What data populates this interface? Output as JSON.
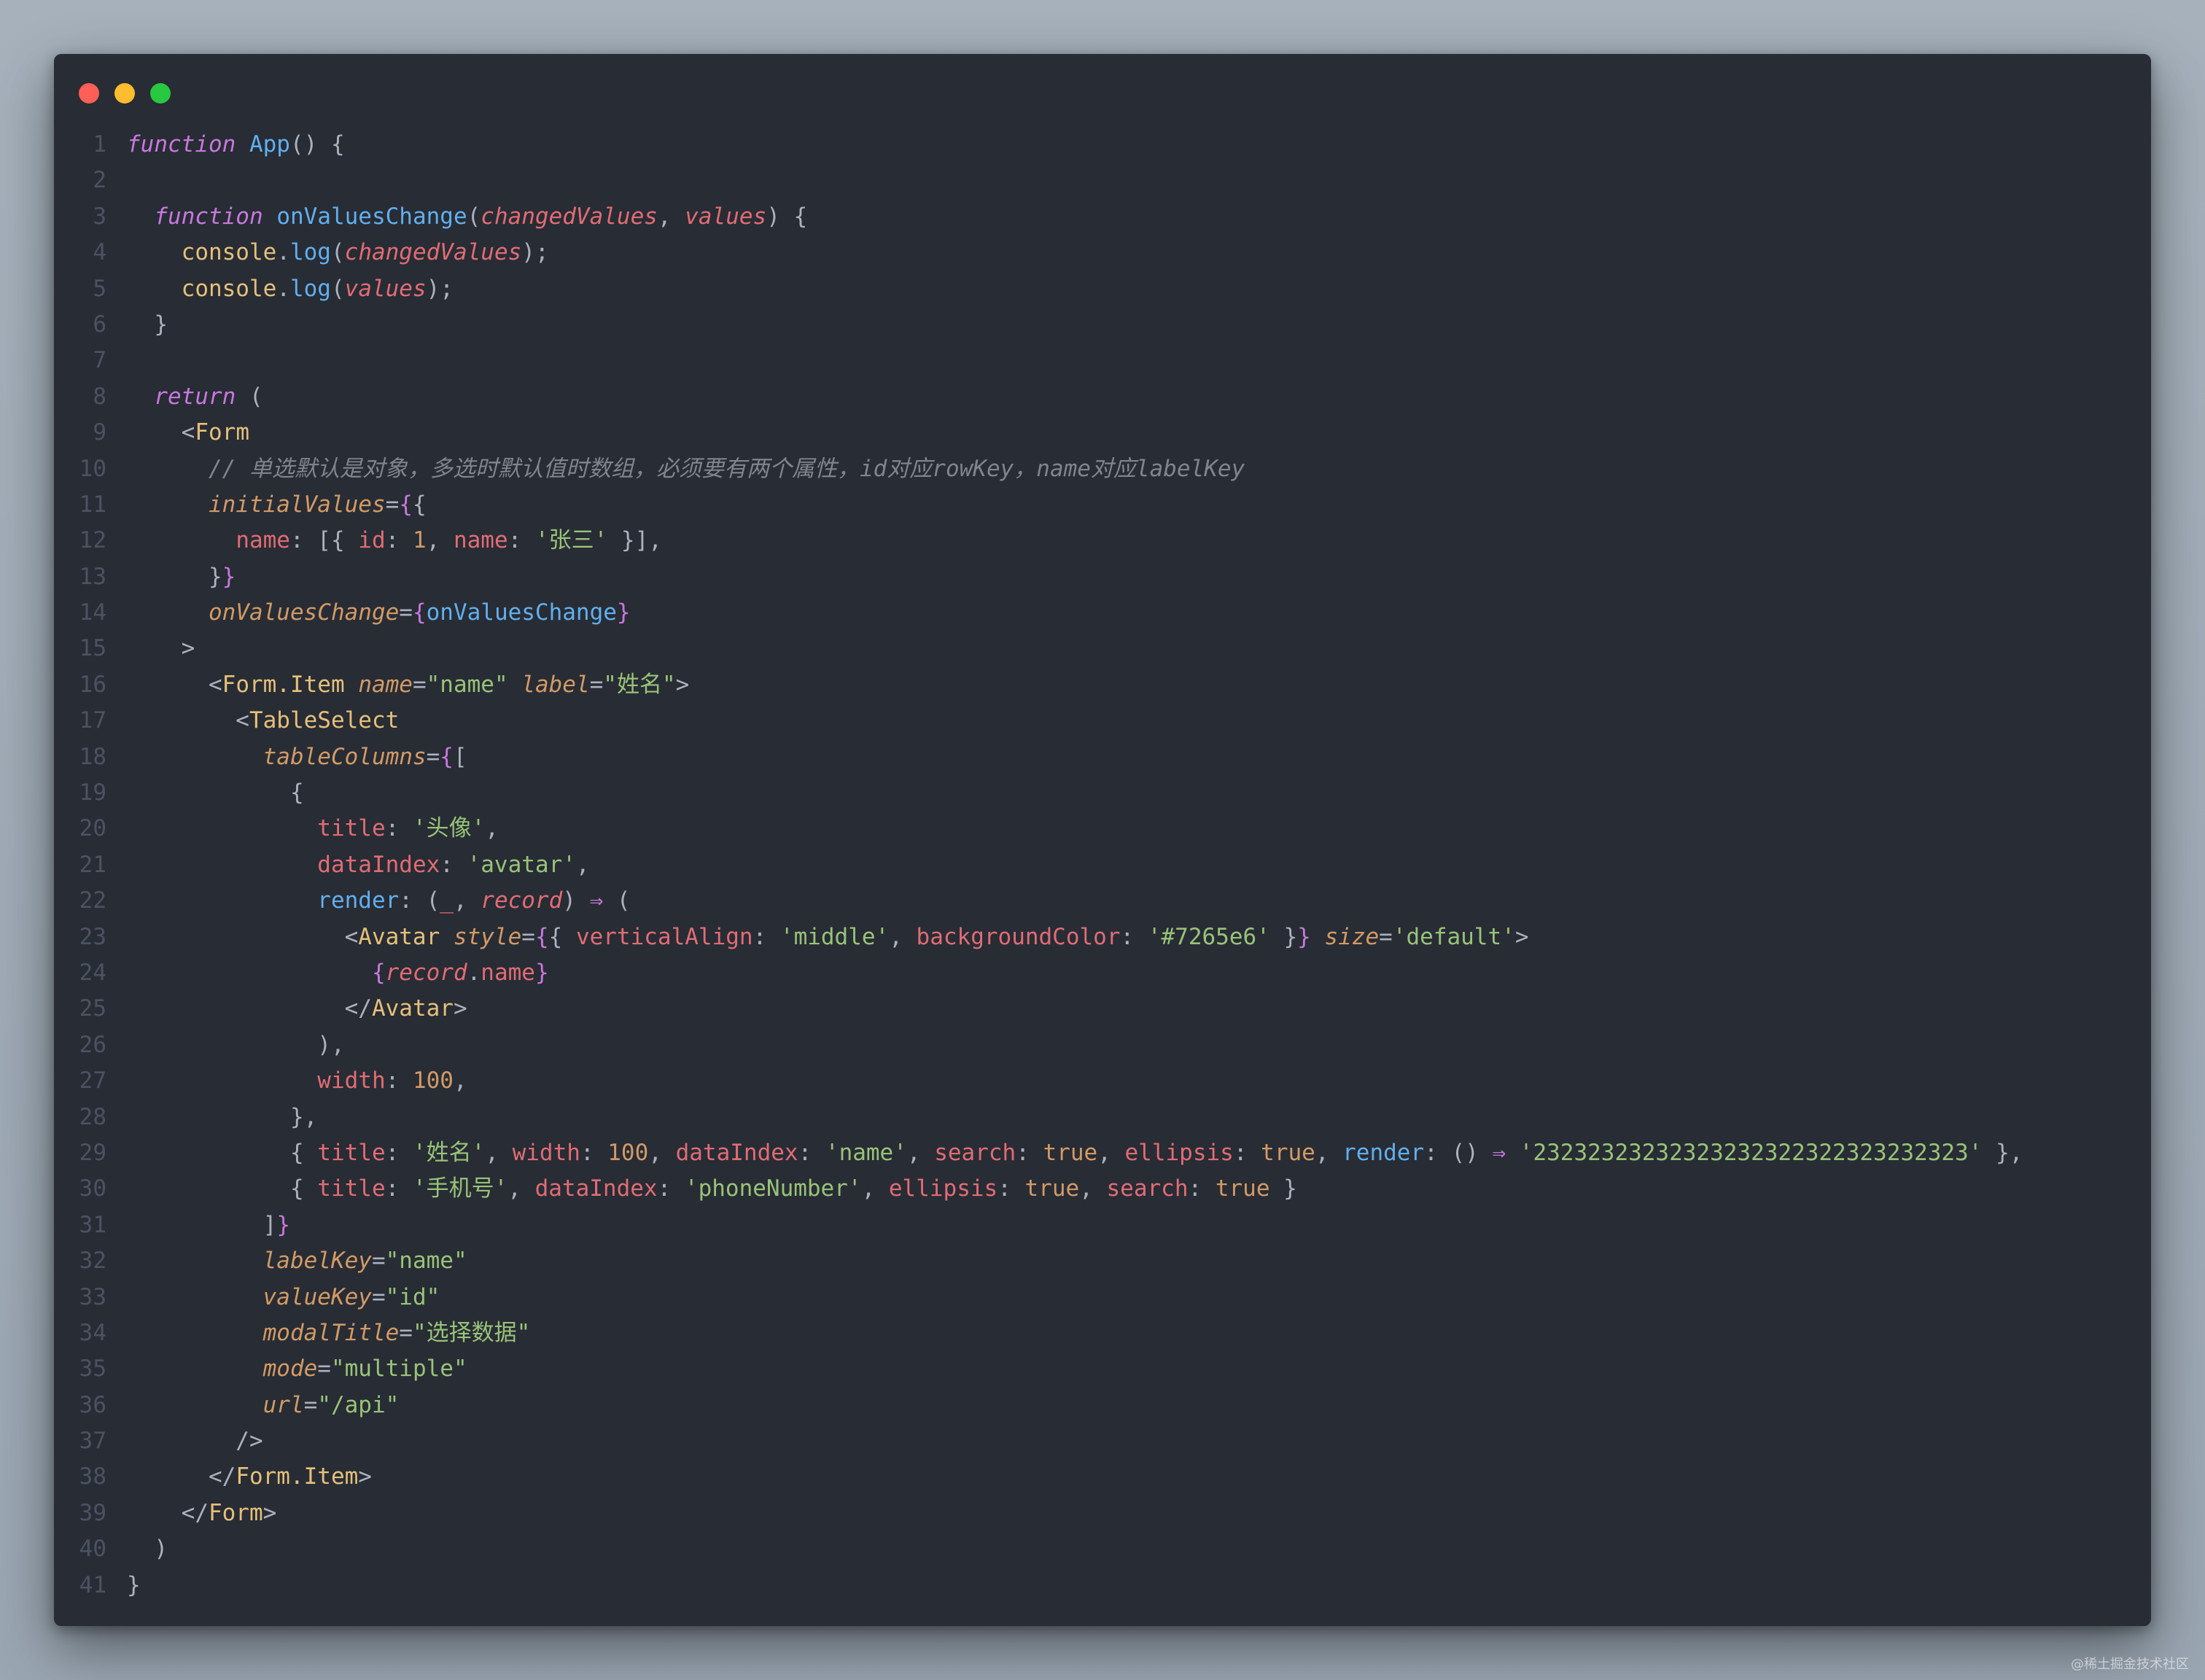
{
  "window": {
    "traffic_lights": [
      {
        "name": "close",
        "color": "#ff5f57"
      },
      {
        "name": "minimize",
        "color": "#febc2e"
      },
      {
        "name": "maximize",
        "color": "#28c840"
      }
    ]
  },
  "colors": {
    "background": "#282c34",
    "kw": "#c678dd",
    "fn": "#61afef",
    "param": "#e06c75",
    "prop": "#e06c75",
    "str": "#98c379",
    "num": "#d19a66",
    "attr": "#d19a66",
    "tag": "#e5c07b",
    "comment": "#7f848e",
    "punc": "#abb2bf",
    "brace": "#c678dd",
    "obj": "#e5c07b",
    "bool": "#d19a66"
  },
  "code": {
    "lines": [
      {
        "n": "1",
        "t": [
          [
            "kw",
            "function",
            1
          ],
          [
            "p",
            " "
          ],
          [
            "fn",
            "App"
          ],
          [
            "p",
            "() {"
          ]
        ]
      },
      {
        "n": "2",
        "t": []
      },
      {
        "n": "3",
        "t": [
          [
            "p",
            "  "
          ],
          [
            "kw",
            "function",
            1
          ],
          [
            "p",
            " "
          ],
          [
            "fn",
            "onValuesChange"
          ],
          [
            "p",
            "("
          ],
          [
            "param",
            "changedValues",
            1
          ],
          [
            "p",
            ", "
          ],
          [
            "param",
            "values",
            1
          ],
          [
            "p",
            ") {"
          ]
        ]
      },
      {
        "n": "4",
        "t": [
          [
            "p",
            "    "
          ],
          [
            "obj",
            "console"
          ],
          [
            "p",
            "."
          ],
          [
            "fn",
            "log"
          ],
          [
            "p",
            "("
          ],
          [
            "param",
            "changedValues",
            1
          ],
          [
            "p",
            ");"
          ]
        ]
      },
      {
        "n": "5",
        "t": [
          [
            "p",
            "    "
          ],
          [
            "obj",
            "console"
          ],
          [
            "p",
            "."
          ],
          [
            "fn",
            "log"
          ],
          [
            "p",
            "("
          ],
          [
            "param",
            "values",
            1
          ],
          [
            "p",
            ");"
          ]
        ]
      },
      {
        "n": "6",
        "t": [
          [
            "p",
            "  }"
          ]
        ]
      },
      {
        "n": "7",
        "t": []
      },
      {
        "n": "8",
        "t": [
          [
            "p",
            "  "
          ],
          [
            "kw",
            "return",
            1
          ],
          [
            "p",
            " ("
          ]
        ]
      },
      {
        "n": "9",
        "t": [
          [
            "p",
            "    <"
          ],
          [
            "tag",
            "Form"
          ]
        ]
      },
      {
        "n": "10",
        "t": [
          [
            "p",
            "      "
          ],
          [
            "comment",
            "// 单选默认是对象，多选时默认值时数组，必须要有两个属性，id对应rowKey，name对应labelKey",
            1
          ]
        ]
      },
      {
        "n": "11",
        "t": [
          [
            "p",
            "      "
          ],
          [
            "attr",
            "initialValues",
            1
          ],
          [
            "p",
            "="
          ],
          [
            "brace",
            "{"
          ],
          [
            "p",
            "{"
          ]
        ]
      },
      {
        "n": "12",
        "t": [
          [
            "p",
            "        "
          ],
          [
            "prop",
            "name"
          ],
          [
            "p",
            ": [{ "
          ],
          [
            "prop",
            "id"
          ],
          [
            "p",
            ": "
          ],
          [
            "num",
            "1"
          ],
          [
            "p",
            ", "
          ],
          [
            "prop",
            "name"
          ],
          [
            "p",
            ": "
          ],
          [
            "str",
            "'张三'"
          ],
          [
            "p",
            " }],"
          ]
        ]
      },
      {
        "n": "13",
        "t": [
          [
            "p",
            "      }"
          ],
          [
            "brace",
            "}"
          ]
        ]
      },
      {
        "n": "14",
        "t": [
          [
            "p",
            "      "
          ],
          [
            "attr",
            "onValuesChange",
            1
          ],
          [
            "p",
            "="
          ],
          [
            "brace",
            "{"
          ],
          [
            "fn",
            "onValuesChange"
          ],
          [
            "brace",
            "}"
          ]
        ]
      },
      {
        "n": "15",
        "t": [
          [
            "p",
            "    >"
          ]
        ]
      },
      {
        "n": "16",
        "t": [
          [
            "p",
            "      <"
          ],
          [
            "tag",
            "Form.Item"
          ],
          [
            "p",
            " "
          ],
          [
            "attr",
            "name",
            1
          ],
          [
            "p",
            "="
          ],
          [
            "str",
            "\"name\""
          ],
          [
            "p",
            " "
          ],
          [
            "attr",
            "label",
            1
          ],
          [
            "p",
            "="
          ],
          [
            "str",
            "\"姓名\""
          ],
          [
            "p",
            ">"
          ]
        ]
      },
      {
        "n": "17",
        "t": [
          [
            "p",
            "        <"
          ],
          [
            "tag",
            "TableSelect"
          ]
        ]
      },
      {
        "n": "18",
        "t": [
          [
            "p",
            "          "
          ],
          [
            "attr",
            "tableColumns",
            1
          ],
          [
            "p",
            "="
          ],
          [
            "brace",
            "{"
          ],
          [
            "p",
            "["
          ]
        ]
      },
      {
        "n": "19",
        "t": [
          [
            "p",
            "            {"
          ]
        ]
      },
      {
        "n": "20",
        "t": [
          [
            "p",
            "              "
          ],
          [
            "prop",
            "title"
          ],
          [
            "p",
            ": "
          ],
          [
            "str",
            "'头像'"
          ],
          [
            "p",
            ","
          ]
        ]
      },
      {
        "n": "21",
        "t": [
          [
            "p",
            "              "
          ],
          [
            "prop",
            "dataIndex"
          ],
          [
            "p",
            ": "
          ],
          [
            "str",
            "'avatar'"
          ],
          [
            "p",
            ","
          ]
        ]
      },
      {
        "n": "22",
        "t": [
          [
            "p",
            "              "
          ],
          [
            "fn",
            "render"
          ],
          [
            "p",
            ": ("
          ],
          [
            "param",
            "_"
          ],
          [
            "p",
            ", "
          ],
          [
            "param",
            "record",
            1
          ],
          [
            "p",
            ") "
          ],
          [
            "kw",
            "⇒"
          ],
          [
            "p",
            " ("
          ]
        ]
      },
      {
        "n": "23",
        "t": [
          [
            "p",
            "                <"
          ],
          [
            "tag",
            "Avatar"
          ],
          [
            "p",
            " "
          ],
          [
            "attr",
            "style",
            1
          ],
          [
            "p",
            "="
          ],
          [
            "brace",
            "{"
          ],
          [
            "p",
            "{ "
          ],
          [
            "prop",
            "verticalAlign"
          ],
          [
            "p",
            ": "
          ],
          [
            "str",
            "'middle'"
          ],
          [
            "p",
            ", "
          ],
          [
            "prop",
            "backgroundColor"
          ],
          [
            "p",
            ": "
          ],
          [
            "str",
            "'#7265e6'"
          ],
          [
            "p",
            " }"
          ],
          [
            "brace",
            "}"
          ],
          [
            "p",
            " "
          ],
          [
            "attr",
            "size",
            1
          ],
          [
            "p",
            "="
          ],
          [
            "str",
            "'default'"
          ],
          [
            "p",
            ">"
          ]
        ]
      },
      {
        "n": "24",
        "t": [
          [
            "p",
            "                  "
          ],
          [
            "brace",
            "{"
          ],
          [
            "param",
            "record",
            1
          ],
          [
            "p",
            "."
          ],
          [
            "prop",
            "name"
          ],
          [
            "brace",
            "}"
          ]
        ]
      },
      {
        "n": "25",
        "t": [
          [
            "p",
            "                </"
          ],
          [
            "tag",
            "Avatar"
          ],
          [
            "p",
            ">"
          ]
        ]
      },
      {
        "n": "26",
        "t": [
          [
            "p",
            "              ),"
          ]
        ]
      },
      {
        "n": "27",
        "t": [
          [
            "p",
            "              "
          ],
          [
            "prop",
            "width"
          ],
          [
            "p",
            ": "
          ],
          [
            "num",
            "100"
          ],
          [
            "p",
            ","
          ]
        ]
      },
      {
        "n": "28",
        "t": [
          [
            "p",
            "            },"
          ]
        ]
      },
      {
        "n": "29",
        "t": [
          [
            "p",
            "            { "
          ],
          [
            "prop",
            "title"
          ],
          [
            "p",
            ": "
          ],
          [
            "str",
            "'姓名'"
          ],
          [
            "p",
            ", "
          ],
          [
            "prop",
            "width"
          ],
          [
            "p",
            ": "
          ],
          [
            "num",
            "100"
          ],
          [
            "p",
            ", "
          ],
          [
            "prop",
            "dataIndex"
          ],
          [
            "p",
            ": "
          ],
          [
            "str",
            "'name'"
          ],
          [
            "p",
            ", "
          ],
          [
            "prop",
            "search"
          ],
          [
            "p",
            ": "
          ],
          [
            "bool",
            "true"
          ],
          [
            "p",
            ", "
          ],
          [
            "prop",
            "ellipsis"
          ],
          [
            "p",
            ": "
          ],
          [
            "bool",
            "true"
          ],
          [
            "p",
            ", "
          ],
          [
            "fn",
            "render"
          ],
          [
            "p",
            ": () "
          ],
          [
            "kw",
            "⇒"
          ],
          [
            "p",
            " "
          ],
          [
            "str",
            "'23232323232323232322322323232323'"
          ],
          [
            "p",
            " },"
          ]
        ]
      },
      {
        "n": "30",
        "t": [
          [
            "p",
            "            { "
          ],
          [
            "prop",
            "title"
          ],
          [
            "p",
            ": "
          ],
          [
            "str",
            "'手机号'"
          ],
          [
            "p",
            ", "
          ],
          [
            "prop",
            "dataIndex"
          ],
          [
            "p",
            ": "
          ],
          [
            "str",
            "'phoneNumber'"
          ],
          [
            "p",
            ", "
          ],
          [
            "prop",
            "ellipsis"
          ],
          [
            "p",
            ": "
          ],
          [
            "bool",
            "true"
          ],
          [
            "p",
            ", "
          ],
          [
            "prop",
            "search"
          ],
          [
            "p",
            ": "
          ],
          [
            "bool",
            "true"
          ],
          [
            "p",
            " }"
          ]
        ]
      },
      {
        "n": "31",
        "t": [
          [
            "p",
            "          ]"
          ],
          [
            "brace",
            "}"
          ]
        ]
      },
      {
        "n": "32",
        "t": [
          [
            "p",
            "          "
          ],
          [
            "attr",
            "labelKey",
            1
          ],
          [
            "p",
            "="
          ],
          [
            "str",
            "\"name\""
          ]
        ]
      },
      {
        "n": "33",
        "t": [
          [
            "p",
            "          "
          ],
          [
            "attr",
            "valueKey",
            1
          ],
          [
            "p",
            "="
          ],
          [
            "str",
            "\"id\""
          ]
        ]
      },
      {
        "n": "34",
        "t": [
          [
            "p",
            "          "
          ],
          [
            "attr",
            "modalTitle",
            1
          ],
          [
            "p",
            "="
          ],
          [
            "str",
            "\"选择数据\""
          ]
        ]
      },
      {
        "n": "35",
        "t": [
          [
            "p",
            "          "
          ],
          [
            "attr",
            "mode",
            1
          ],
          [
            "p",
            "="
          ],
          [
            "str",
            "\"multiple\""
          ]
        ]
      },
      {
        "n": "36",
        "t": [
          [
            "p",
            "          "
          ],
          [
            "attr",
            "url",
            1
          ],
          [
            "p",
            "="
          ],
          [
            "str",
            "\"/api\""
          ]
        ]
      },
      {
        "n": "37",
        "t": [
          [
            "p",
            "        />"
          ]
        ]
      },
      {
        "n": "38",
        "t": [
          [
            "p",
            "      </"
          ],
          [
            "tag",
            "Form.Item"
          ],
          [
            "p",
            ">"
          ]
        ]
      },
      {
        "n": "39",
        "t": [
          [
            "p",
            "    </"
          ],
          [
            "tag",
            "Form"
          ],
          [
            "p",
            ">"
          ]
        ]
      },
      {
        "n": "40",
        "t": [
          [
            "p",
            "  )"
          ]
        ]
      },
      {
        "n": "41",
        "t": [
          [
            "p",
            "}"
          ]
        ]
      }
    ]
  },
  "watermark": "@稀土掘金技术社区"
}
